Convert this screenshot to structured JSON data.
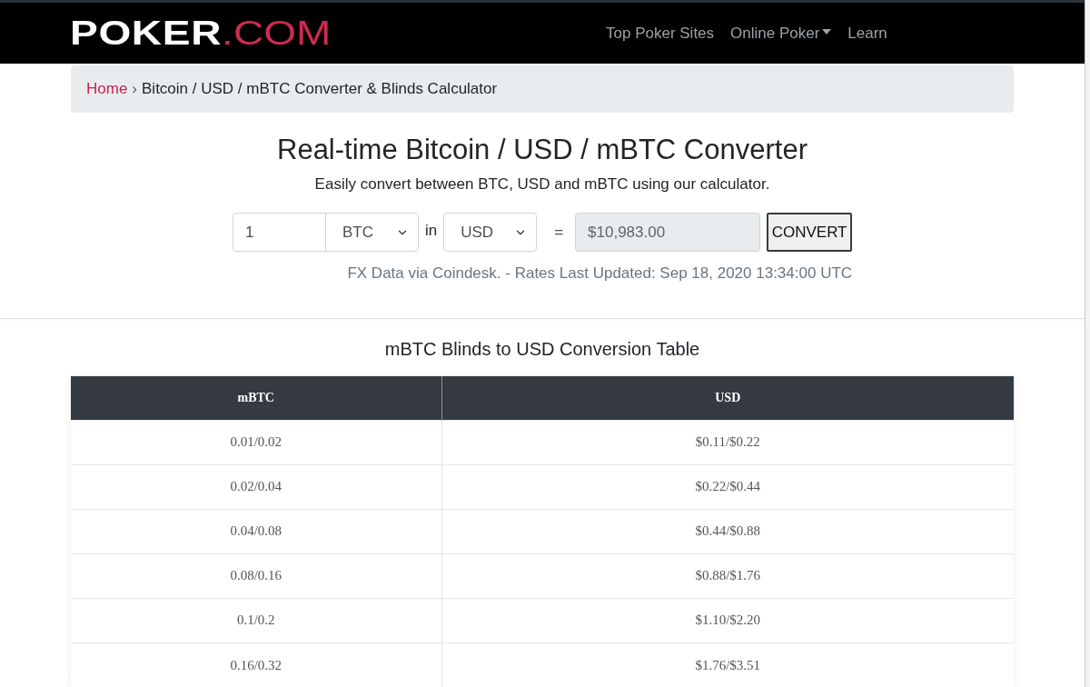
{
  "nav": {
    "logo": {
      "name": "POKER",
      "domain": ".COM"
    },
    "links": [
      {
        "label": "Top Poker Sites",
        "kind": "link"
      },
      {
        "label": "Online Poker",
        "kind": "dropdown"
      },
      {
        "label": "Learn",
        "kind": "link"
      }
    ]
  },
  "breadcrumb": {
    "separator": "›",
    "items": [
      {
        "label": "Home",
        "kind": "link"
      },
      {
        "label": "Bitcoin / USD / mBTC Converter & Blinds Calculator",
        "kind": "current"
      }
    ]
  },
  "converter": {
    "title": "Real-time Bitcoin / USD / mBTC Converter",
    "subtitle": "Easily convert between BTC, USD and mBTC using our calculator.",
    "amount": {
      "value": "1"
    },
    "from_currency": {
      "value": "BTC"
    },
    "in_label": "in",
    "to_currency": {
      "value": "USD"
    },
    "equals": "=",
    "result": {
      "value": "$10,983.00"
    },
    "convert_button": "CONVERT",
    "source_note": "FX Data via Coindesk. - Rates Last Updated: Sep 18, 2020 13:34:00 UTC"
  },
  "blinds_table": {
    "title": "mBTC Blinds to USD Conversion Table",
    "columns": [
      "mBTC",
      "USD"
    ],
    "rows": [
      [
        "0.01/0.02",
        "$0.11/$0.22"
      ],
      [
        "0.02/0.04",
        "$0.22/$0.44"
      ],
      [
        "0.04/0.08",
        "$0.44/$0.88"
      ],
      [
        "0.08/0.16",
        "$0.88/$1.76"
      ],
      [
        "0.1/0.2",
        "$1.10/$2.20"
      ],
      [
        "0.16/0.32",
        "$1.76/$3.51"
      ]
    ]
  }
}
